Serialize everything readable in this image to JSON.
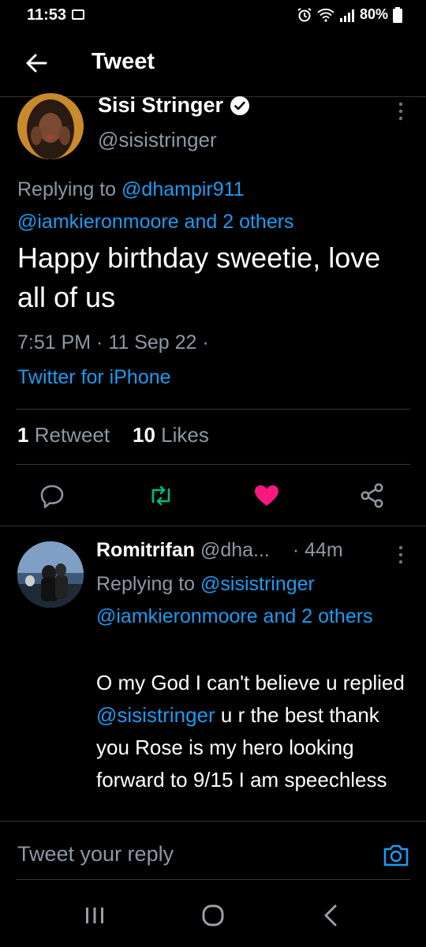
{
  "status_bar": {
    "time": "11:53",
    "battery": "80%"
  },
  "header": {
    "title": "Tweet"
  },
  "tweet": {
    "author_name": "Sisi Stringer",
    "author_handle": "@sisistringer",
    "replying_prefix": "Replying to",
    "replying_to_1": "@dhampir911",
    "replying_to_2": "@iamkieronmoore and 2 others",
    "text": "Happy birthday sweetie, love all of us",
    "meta": "7:51 PM · 11 Sep 22 ·",
    "source": "Twitter for iPhone",
    "retweets_count": "1",
    "retweets_label": "Retweet",
    "likes_count": "10",
    "likes_label": "Likes"
  },
  "reply": {
    "name": "Romitrifan",
    "handle": "@dha...",
    "time": "· 44m",
    "replying_prefix": "Replying to",
    "replying_to": "@sisistringer",
    "replying_rest": "@iamkieronmoore and 2 others",
    "text_1": "O my God I can't believe u replied",
    "mention": "@sisistringer",
    "text_2": "u r the best thank you Rose is my hero looking forward to 9/15 I am speechless"
  },
  "compose": {
    "placeholder": "Tweet your reply"
  },
  "colors": {
    "accent": "#1d9bf0",
    "retweet": "#00ba7c",
    "like": "#f91880",
    "secondary_text": "#8b98a5"
  },
  "icons": {
    "back": "arrow-left-icon",
    "verified": "verified-badge-icon",
    "more": "more-vertical-icon",
    "reply": "reply-icon",
    "retweet": "retweet-icon",
    "like": "heart-icon",
    "share": "share-icon",
    "camera": "camera-icon",
    "recent_apps": "recent-apps-icon",
    "home": "home-icon",
    "nav_back": "nav-back-icon"
  }
}
